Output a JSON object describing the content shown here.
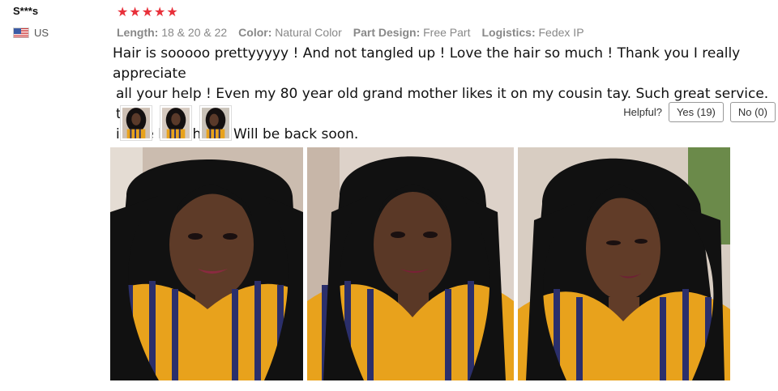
{
  "reviewer": {
    "name": "S***s",
    "country": "US",
    "flag_icon": "us-flag-icon"
  },
  "review": {
    "rating": 5,
    "star_color": "#e8303a",
    "attributes": [
      {
        "key": "Length:",
        "value": "18 & 20 & 22"
      },
      {
        "key": "Color:",
        "value": "Natural Color"
      },
      {
        "key": "Part Design:",
        "value": "Free Part"
      },
      {
        "key": "Logistics:",
        "value": "Fedex IP"
      }
    ],
    "comment_lines": [
      "Hair is sooooo prettyyyyy ! And not tangled up ! Love the hair so much ! Thank you I really appreciate",
      "all your help ! Even my 80 year old grand mother likes it on my cousin tay. Such great service. this",
      "is the best hair ! Will be back soon."
    ]
  },
  "helpful": {
    "label": "Helpful?",
    "yes_label": "Yes (19)",
    "no_label": "No (0)"
  },
  "thumbnails": [
    {
      "icon": "photo-thumbnail-1"
    },
    {
      "icon": "photo-thumbnail-2"
    },
    {
      "icon": "photo-thumbnail-3"
    }
  ],
  "photos": [
    {
      "icon": "review-photo-1"
    },
    {
      "icon": "review-photo-2"
    },
    {
      "icon": "review-photo-3"
    }
  ]
}
